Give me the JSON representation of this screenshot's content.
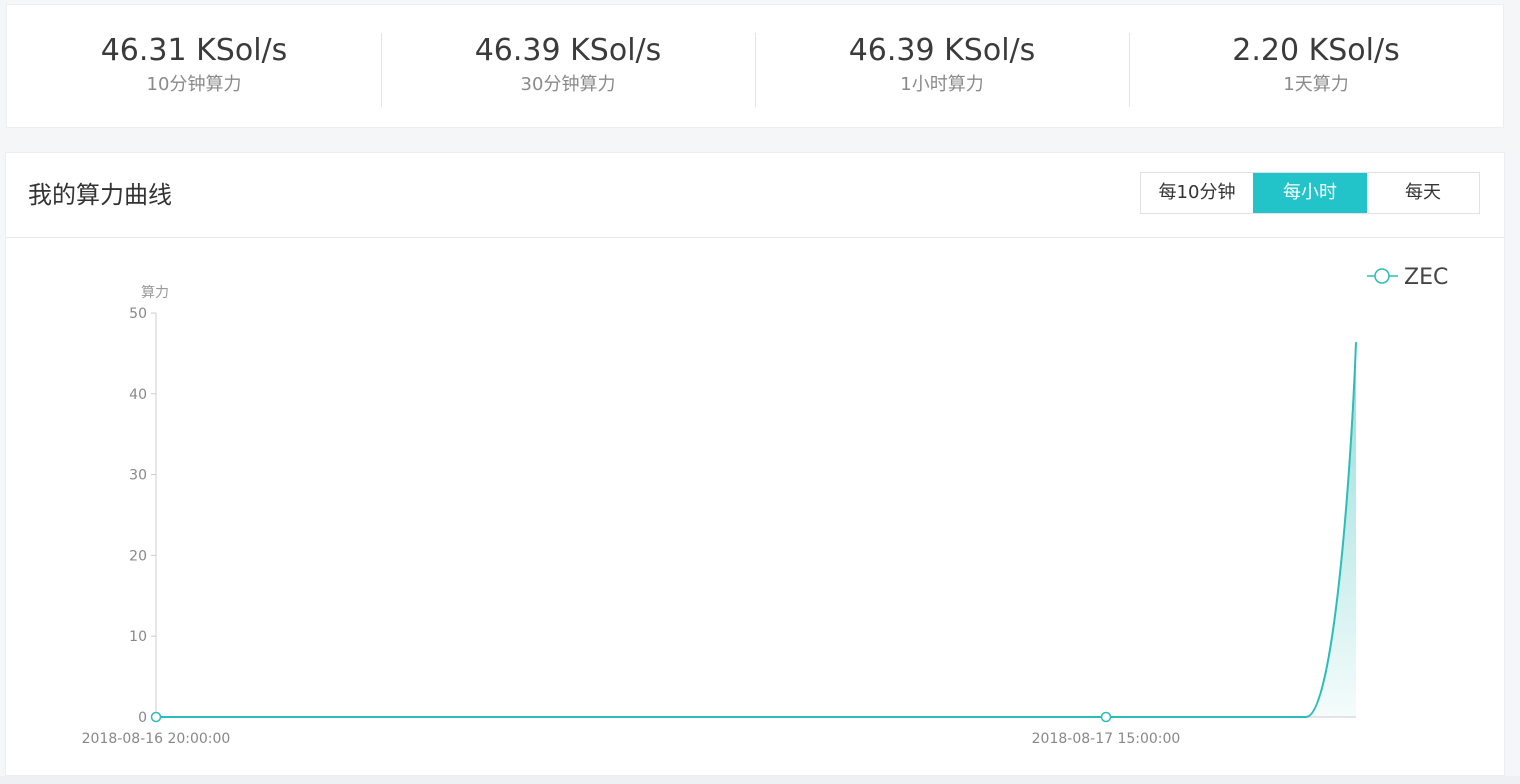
{
  "stats": [
    {
      "value": "46.31 KSol/s",
      "label": "10分钟算力"
    },
    {
      "value": "46.39 KSol/s",
      "label": "30分钟算力"
    },
    {
      "value": "46.39 KSol/s",
      "label": "1小时算力"
    },
    {
      "value": "2.20 KSol/s",
      "label": "1天算力"
    }
  ],
  "chart_panel": {
    "title": "我的算力曲线",
    "period_buttons": [
      {
        "label": "每10分钟",
        "active": false
      },
      {
        "label": "每小时",
        "active": true
      },
      {
        "label": "每天",
        "active": false
      }
    ]
  },
  "colors": {
    "accent": "#22c3c9",
    "line": "#2bbdb8",
    "area_top": "#7fd6d3"
  },
  "chart_data": {
    "type": "area",
    "ylabel": "算力",
    "xlabel": "",
    "ylim": [
      0,
      50
    ],
    "yticks": [
      0,
      10,
      20,
      30,
      40,
      50
    ],
    "x_tick_labels": [
      "2018-08-16 20:00:00",
      "2018-08-17 15:00:00"
    ],
    "x_range_hours": [
      0,
      24
    ],
    "x_tick_hours": [
      0,
      19
    ],
    "series": [
      {
        "name": "ZEC",
        "points": [
          {
            "h": 0,
            "v": 0
          },
          {
            "h": 1,
            "v": 0
          },
          {
            "h": 2,
            "v": 0
          },
          {
            "h": 3,
            "v": 0
          },
          {
            "h": 4,
            "v": 0
          },
          {
            "h": 5,
            "v": 0
          },
          {
            "h": 6,
            "v": 0
          },
          {
            "h": 7,
            "v": 0
          },
          {
            "h": 8,
            "v": 0
          },
          {
            "h": 9,
            "v": 0
          },
          {
            "h": 10,
            "v": 0
          },
          {
            "h": 11,
            "v": 0
          },
          {
            "h": 12,
            "v": 0
          },
          {
            "h": 13,
            "v": 0
          },
          {
            "h": 14,
            "v": 0
          },
          {
            "h": 15,
            "v": 0
          },
          {
            "h": 16,
            "v": 0
          },
          {
            "h": 17,
            "v": 0
          },
          {
            "h": 18,
            "v": 0
          },
          {
            "h": 19,
            "v": 0
          },
          {
            "h": 20,
            "v": 0
          },
          {
            "h": 21,
            "v": 0
          },
          {
            "h": 22,
            "v": 0
          },
          {
            "h": 23,
            "v": 0
          },
          {
            "h": 24,
            "v": 46.39
          }
        ]
      }
    ],
    "legend": "top-right",
    "grid": false
  }
}
